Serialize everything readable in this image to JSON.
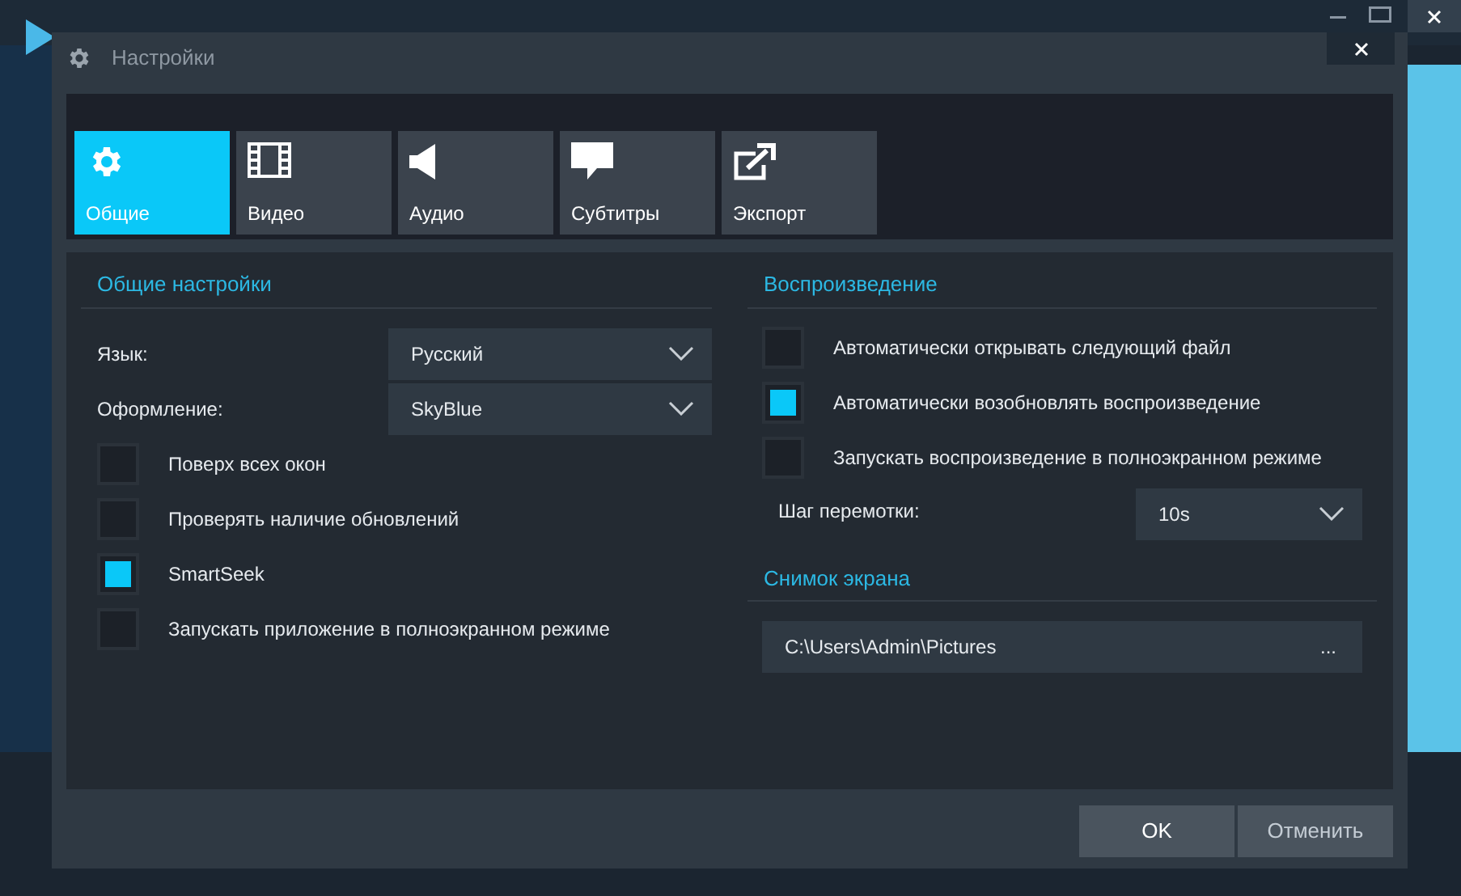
{
  "dialog": {
    "title": "Настройки"
  },
  "tabs": [
    {
      "label": "Общие",
      "selected": true,
      "kind": "gear"
    },
    {
      "label": "Видео",
      "selected": false,
      "kind": "film"
    },
    {
      "label": "Аудио",
      "selected": false,
      "kind": "speaker"
    },
    {
      "label": "Субтитры",
      "selected": false,
      "kind": "bubble"
    },
    {
      "label": "Экспорт",
      "selected": false,
      "kind": "export"
    }
  ],
  "general": {
    "title": "Общие настройки",
    "dropdowns": [
      {
        "label": "Язык:",
        "value": "Русский"
      },
      {
        "label": "Оформление:",
        "value": "SkyBlue"
      }
    ],
    "checkboxes": [
      {
        "label": "Поверх всех окон",
        "checked": false
      },
      {
        "label": "Проверять наличие обновлений",
        "checked": false
      },
      {
        "label": "SmartSeek",
        "checked": true
      },
      {
        "label": "Запускать приложение в полноэкранном режиме",
        "checked": false
      }
    ]
  },
  "playback": {
    "title": "Воспроизведение",
    "checkboxes": [
      {
        "label": "Автоматически открывать следующий файл",
        "checked": false
      },
      {
        "label": "Автоматически возобновлять воспроизведение",
        "checked": true
      },
      {
        "label": "Запускать воспроизведение в полноэкранном режиме",
        "checked": false
      }
    ],
    "seek_step": {
      "label": "Шаг перемотки:",
      "value": "10s"
    }
  },
  "screenshot": {
    "title": "Снимок экрана",
    "path": "C:\\Users\\Admin\\Pictures",
    "browse": "..."
  },
  "buttons": [
    "OK",
    "Отменить"
  ]
}
